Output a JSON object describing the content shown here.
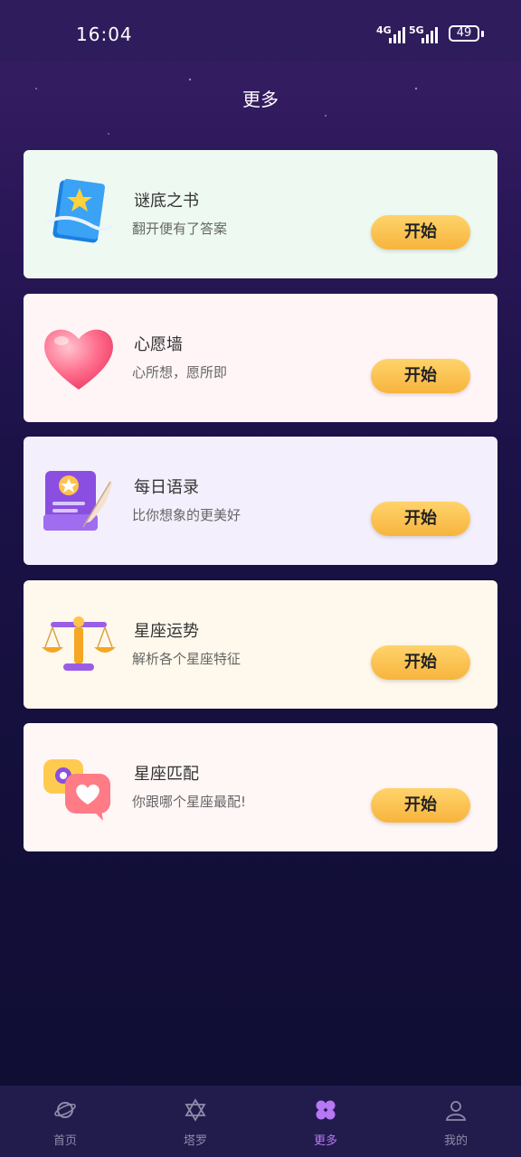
{
  "status_bar": {
    "time": "16:04",
    "network_1": "4G",
    "network_2": "5G",
    "battery": "49"
  },
  "header": {
    "title": "更多"
  },
  "cards": [
    {
      "title": "谜底之书",
      "desc": "翻开便有了答案",
      "button": "开始",
      "bg": "#eefaf1",
      "icon": "blue-book-star-icon"
    },
    {
      "title": "心愿墙",
      "desc": "心所想，愿所即",
      "button": "开始",
      "bg": "#fff5f7",
      "icon": "pink-heart-icon"
    },
    {
      "title": "每日语录",
      "desc": "比你想象的更美好",
      "button": "开始",
      "bg": "#f3effc",
      "icon": "quote-scroll-feather-icon"
    },
    {
      "title": "星座运势",
      "desc": "解析各个星座特征",
      "button": "开始",
      "bg": "#fff8ec",
      "icon": "balance-scale-icon"
    },
    {
      "title": "星座匹配",
      "desc": "你跟哪个星座最配!",
      "button": "开始",
      "bg": "#fff6f6",
      "icon": "heart-chat-bubbles-icon"
    }
  ],
  "tabbar": {
    "items": [
      {
        "label": "首页",
        "icon": "planet-icon",
        "active": false
      },
      {
        "label": "塔罗",
        "icon": "hexagram-icon",
        "active": false
      },
      {
        "label": "更多",
        "icon": "four-petal-icon",
        "active": true
      },
      {
        "label": "我的",
        "icon": "user-profile-icon",
        "active": false
      }
    ]
  },
  "colors": {
    "button_gradient_top": "#ffd36b",
    "button_gradient_bottom": "#f7b43d",
    "active_tab": "#b877f4",
    "inactive_tab": "#8f8aa9"
  }
}
